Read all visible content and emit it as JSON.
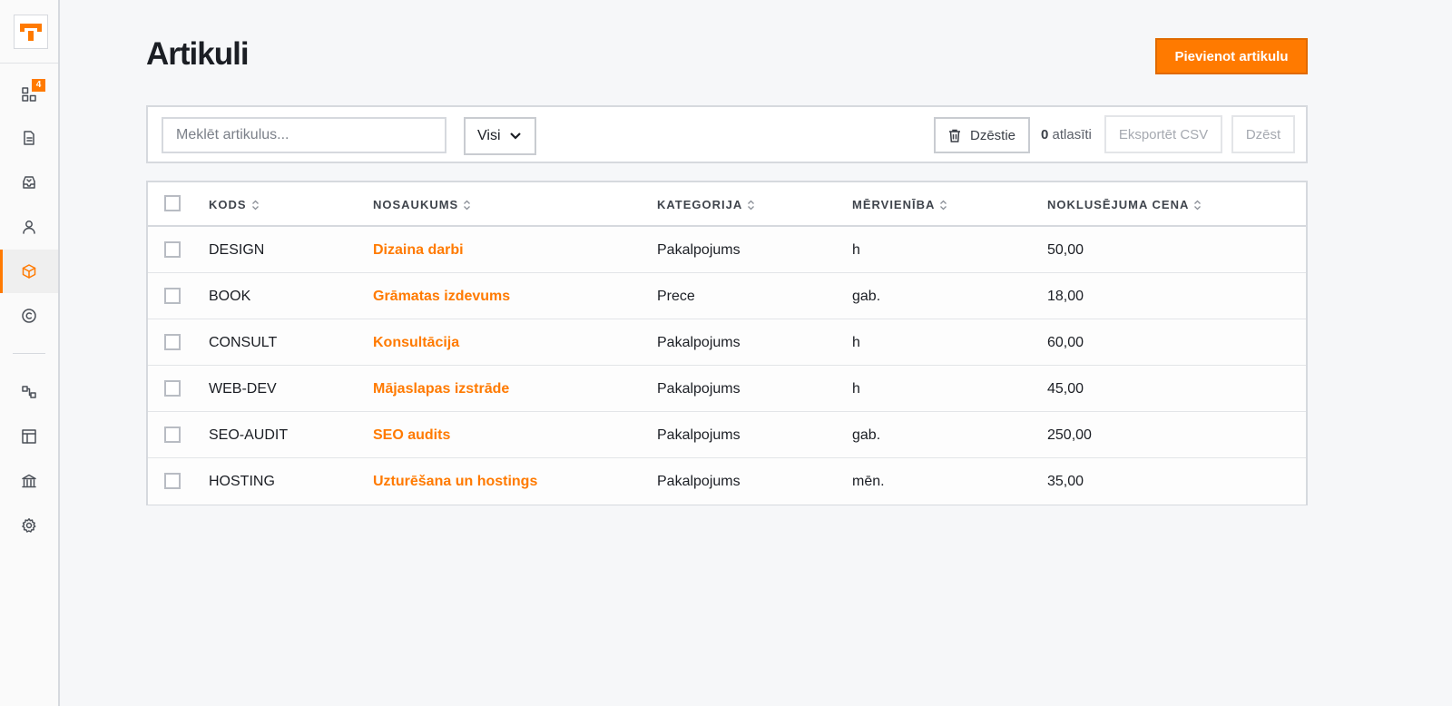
{
  "sidebar": {
    "badge_count": "4",
    "accent_color": "#ff7a00",
    "items": [
      {
        "name": "dashboard",
        "icon": "dashboard-icon"
      },
      {
        "name": "documents",
        "icon": "document-icon"
      },
      {
        "name": "inbox",
        "icon": "inbox-icon"
      },
      {
        "name": "clients",
        "icon": "user-icon"
      },
      {
        "name": "articles",
        "icon": "box-icon",
        "active": true
      },
      {
        "name": "copyright",
        "icon": "copyright-icon"
      },
      {
        "name": "integrations",
        "icon": "flow-icon"
      },
      {
        "name": "templates",
        "icon": "layout-icon"
      },
      {
        "name": "bank",
        "icon": "bank-icon"
      },
      {
        "name": "settings",
        "icon": "gear-icon"
      }
    ]
  },
  "header": {
    "title": "Artikuli",
    "add_button": "Pievienot artikulu"
  },
  "toolbar": {
    "search_placeholder": "Meklēt artikulus...",
    "filter_value": "Visi",
    "delete_filter_label": "Dzēstie",
    "selected_count": "0",
    "selected_label": "atlasīti",
    "export_label": "Eksportēt CSV",
    "bulk_delete_label": "Dzēst"
  },
  "table": {
    "columns": [
      "KODS",
      "NOSAUKUMS",
      "KATEGORIJA",
      "MĒRVIENĪBA",
      "NOKLUSĒJUMA CENA"
    ],
    "rows": [
      {
        "code": "DESIGN",
        "name": "Dizaina darbi",
        "category": "Pakalpojums",
        "unit": "h",
        "price": "50,00"
      },
      {
        "code": "BOOK",
        "name": "Grāmatas izdevums",
        "category": "Prece",
        "unit": "gab.",
        "price": "18,00"
      },
      {
        "code": "CONSULT",
        "name": "Konsultācija",
        "category": "Pakalpojums",
        "unit": "h",
        "price": "60,00"
      },
      {
        "code": "WEB-DEV",
        "name": "Mājaslapas izstrāde",
        "category": "Pakalpojums",
        "unit": "h",
        "price": "45,00"
      },
      {
        "code": "SEO-AUDIT",
        "name": "SEO audits",
        "category": "Pakalpojums",
        "unit": "gab.",
        "price": "250,00"
      },
      {
        "code": "HOSTING",
        "name": "Uzturēšana un hostings",
        "category": "Pakalpojums",
        "unit": "mēn.",
        "price": "35,00"
      }
    ]
  }
}
